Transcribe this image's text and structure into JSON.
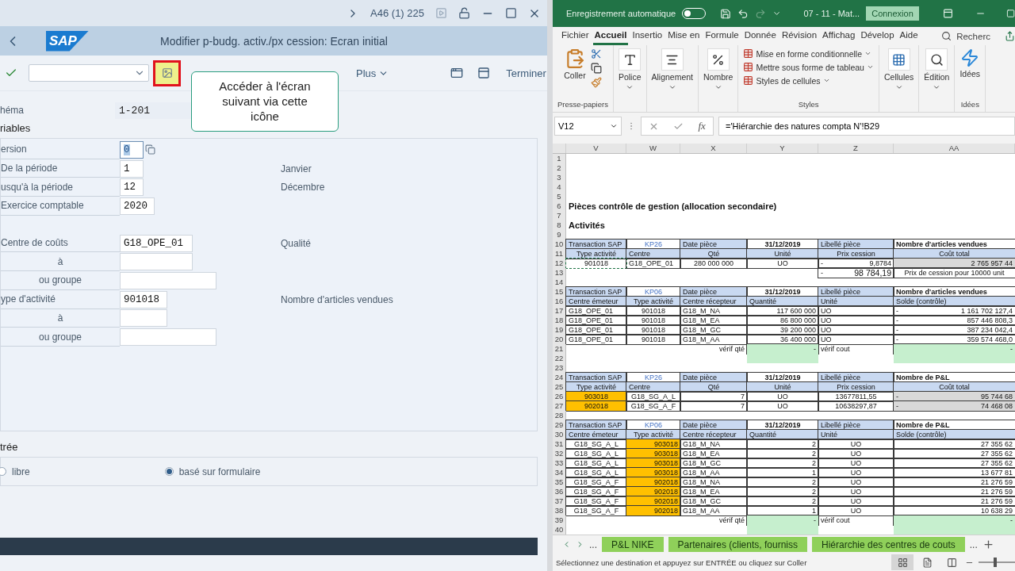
{
  "sap": {
    "titlebar": {
      "session": "A46 (1) 225"
    },
    "header": {
      "logo": "SAP",
      "title": "Modifier p-budg. activ./px cession: Ecran initial"
    },
    "toolbar": {
      "more": "Plus",
      "exit": "Terminer"
    },
    "tooltip": "Accéder à l'écran suivant via cette icône",
    "schema": {
      "label": "héma",
      "value": "1-201"
    },
    "section": "riables",
    "field_groups": [
      [
        {
          "kind": "main",
          "label": "ersion",
          "value": "0",
          "focused": true
        },
        {
          "kind": "main",
          "label": "De la période",
          "value": "1",
          "note": "Janvier",
          "focused": false
        },
        {
          "kind": "main",
          "label": "usqu'à la période",
          "value": "12",
          "note": "Décembre",
          "focused": false
        },
        {
          "kind": "main",
          "label": "Exercice comptable",
          "value": "2020",
          "focused": false
        }
      ],
      [
        {
          "kind": "main",
          "label": "Centre de coûts",
          "value": "G18_OPE_01",
          "note": "Qualité",
          "focused": false
        },
        {
          "kind": "to",
          "label": "à",
          "focused": false
        },
        {
          "kind": "group",
          "label": "ou groupe",
          "focused": false
        },
        {
          "kind": "main",
          "label": "ype d'activité",
          "value": "901018",
          "note": "Nombre d'articles vendues",
          "focused": false
        },
        {
          "kind": "to",
          "label": "à",
          "focused": false
        },
        {
          "kind": "group",
          "label": "ou groupe",
          "focused": false
        }
      ]
    ],
    "entry": {
      "heading": "trée",
      "options": [
        {
          "label": "libre",
          "selected": false
        },
        {
          "label": "basé sur formulaire",
          "selected": true
        }
      ]
    }
  },
  "excel": {
    "titlebar": {
      "autosave": {
        "label": "Enregistrement automatique",
        "on": false
      },
      "redo_disabled": true,
      "file": "07 - 11 - Mat...",
      "signin": "Connexion"
    },
    "tabs": [
      {
        "label": "Fichier",
        "selected": false
      },
      {
        "label": "Accueil",
        "selected": true
      },
      {
        "label": "Insertio",
        "selected": false
      },
      {
        "label": "Mise en",
        "selected": false
      },
      {
        "label": "Formule",
        "selected": false
      },
      {
        "label": "Donnée",
        "selected": false
      },
      {
        "label": "Révision",
        "selected": false
      },
      {
        "label": "Affichag",
        "selected": false
      },
      {
        "label": "Dévelop",
        "selected": false
      },
      {
        "label": "Aide",
        "selected": false
      }
    ],
    "search": "Recherc",
    "ribbon": {
      "clipboard": {
        "paste": "Coller",
        "group": "Presse-papiers"
      },
      "buttons": [
        {
          "kind": "font",
          "label": "Police"
        },
        {
          "kind": "align",
          "label": "Alignement"
        },
        {
          "kind": "number",
          "label": "Nombre"
        }
      ],
      "styles": {
        "items": [
          "Mise en forme conditionnelle",
          "Mettre sous forme de tableau",
          "Styles de cellules"
        ],
        "group": "Styles"
      },
      "after": [
        {
          "kind": "cells",
          "label": "Cellules"
        },
        {
          "kind": "edit",
          "label": "Édition"
        },
        {
          "kind": "ideas",
          "label": "Idées",
          "group": "Idées"
        }
      ]
    },
    "namebox": "V12",
    "fx": "fx",
    "formula": "='Hiérarchie des natures compta N'!B29",
    "columns": [
      "V",
      "W",
      "X",
      "Y",
      "Z",
      "AA"
    ],
    "rows": [
      {
        "n": "1",
        "cells": []
      },
      {
        "n": "2",
        "cells": []
      },
      {
        "n": "3",
        "cells": []
      },
      {
        "n": "4",
        "cells": []
      },
      {
        "n": "5",
        "cells": []
      },
      {
        "n": "6",
        "cells": [
          {
            "kind": "title",
            "text": "Pièces contrôle de gestion (allocation secondaire)"
          }
        ]
      },
      {
        "n": "7",
        "cells": []
      },
      {
        "n": "8",
        "cells": [
          {
            "kind": "title",
            "text": "Activités"
          }
        ]
      },
      {
        "n": "9",
        "cells": []
      },
      {
        "n": "10",
        "cells": [
          {
            "kind": "head",
            "text": "Transaction SAP"
          },
          {
            "kind": "link",
            "text": "KP26"
          },
          {
            "kind": "head",
            "text": "Date pièce"
          },
          {
            "kind": "date",
            "text": "31/12/2019"
          },
          {
            "kind": "head",
            "text": "Libellé pièce"
          },
          {
            "kind": "bold",
            "text": "Nombre d'articles vendues"
          }
        ]
      },
      {
        "n": "11",
        "cells": [
          {
            "kind": "headc",
            "text": "Type activité"
          },
          {
            "kind": "head",
            "text": "Centre"
          },
          {
            "kind": "headc",
            "text": "Qté"
          },
          {
            "kind": "headc",
            "text": "Unité"
          },
          {
            "kind": "headc",
            "text": "Prix cession"
          },
          {
            "kind": "headc",
            "text": "Coût total"
          }
        ]
      },
      {
        "n": "12",
        "cells": [
          {
            "kind": "copied",
            "text": "901018"
          },
          {
            "kind": "left",
            "text": "G18_OPE_01"
          },
          {
            "kind": "center",
            "text": "280 000 000"
          },
          {
            "kind": "center",
            "text": "UO"
          },
          {
            "kind": "acct",
            "sign": "-",
            "text": "9,8784"
          },
          {
            "kind": "grey",
            "text": "2 765 957 44"
          }
        ]
      },
      {
        "n": "13",
        "cells": [
          null,
          null,
          null,
          null,
          {
            "kind": "acctbig",
            "sign": "-",
            "text": "98 784,19"
          },
          {
            "kind": "center",
            "text": "Prix de cession pour 10000 unit"
          }
        ]
      },
      {
        "n": "14",
        "cells": []
      },
      {
        "n": "15",
        "cells": [
          {
            "kind": "head",
            "text": "Transaction SAP"
          },
          {
            "kind": "link",
            "text": "KP06"
          },
          {
            "kind": "head",
            "text": "Date pièce"
          },
          {
            "kind": "date",
            "text": "31/12/2019"
          },
          {
            "kind": "head",
            "text": "Libellé pièce"
          },
          {
            "kind": "bold",
            "text": "Nombre d'articles vendues"
          }
        ]
      },
      {
        "n": "16",
        "cells": [
          {
            "kind": "head",
            "text": "Centre émeteur"
          },
          {
            "kind": "headc",
            "text": "Type activité"
          },
          {
            "kind": "head",
            "text": "Centre récepteur"
          },
          {
            "kind": "head",
            "text": "Quantité"
          },
          {
            "kind": "head",
            "text": "Unité"
          },
          {
            "kind": "head",
            "text": "Solde (contrôle)"
          }
        ]
      },
      {
        "n": "17",
        "cells": [
          {
            "kind": "left",
            "text": "G18_OPE_01"
          },
          {
            "kind": "center",
            "text": "901018"
          },
          {
            "kind": "left",
            "text": "G18_M_NA"
          },
          {
            "kind": "right",
            "text": "117 600 000"
          },
          {
            "kind": "left",
            "text": "UO"
          },
          {
            "kind": "acct",
            "sign": "-",
            "text": "1 161 702 127,4"
          }
        ]
      },
      {
        "n": "18",
        "cells": [
          {
            "kind": "left",
            "text": "G18_OPE_01"
          },
          {
            "kind": "center",
            "text": "901018"
          },
          {
            "kind": "left",
            "text": "G18_M_EA"
          },
          {
            "kind": "right",
            "text": "86 800 000"
          },
          {
            "kind": "left",
            "text": "UO"
          },
          {
            "kind": "acct",
            "sign": "-",
            "text": "857 446 808,3"
          }
        ]
      },
      {
        "n": "19",
        "cells": [
          {
            "kind": "left",
            "text": "G18_OPE_01"
          },
          {
            "kind": "center",
            "text": "901018"
          },
          {
            "kind": "left",
            "text": "G18_M_GC"
          },
          {
            "kind": "right",
            "text": "39 200 000"
          },
          {
            "kind": "left",
            "text": "UO"
          },
          {
            "kind": "acct",
            "sign": "-",
            "text": "387 234 042,4"
          }
        ]
      },
      {
        "n": "20",
        "cells": [
          {
            "kind": "left",
            "text": "G18_OPE_01"
          },
          {
            "kind": "center",
            "text": "901018"
          },
          {
            "kind": "left",
            "text": "G18_M_AA"
          },
          {
            "kind": "right",
            "text": "36 400 000"
          },
          {
            "kind": "left",
            "text": "UO"
          },
          {
            "kind": "acct",
            "sign": "-",
            "text": "359 574 468,0"
          }
        ]
      },
      {
        "n": "21",
        "cells": [
          null,
          null,
          {
            "kind": "note",
            "text": "vérif qté"
          },
          {
            "kind": "green",
            "text": "-"
          },
          {
            "kind": "noteleft",
            "text": "vérif cout"
          },
          {
            "kind": "green",
            "text": "-"
          }
        ]
      },
      {
        "n": "22",
        "cells": [
          null,
          null,
          null,
          {
            "kind": "greenopen"
          },
          null,
          {
            "kind": "greenopen"
          }
        ]
      },
      {
        "n": "23",
        "cells": []
      },
      {
        "n": "24",
        "cells": [
          {
            "kind": "head",
            "text": "Transaction SAP"
          },
          {
            "kind": "link",
            "text": "KP26"
          },
          {
            "kind": "head",
            "text": "Date pièce"
          },
          {
            "kind": "date",
            "text": "31/12/2019"
          },
          {
            "kind": "head",
            "text": "Libellé pièce"
          },
          {
            "kind": "bold",
            "text": "Nombre de P&L"
          }
        ]
      },
      {
        "n": "25",
        "cells": [
          {
            "kind": "headc",
            "text": "Type activité"
          },
          {
            "kind": "head",
            "text": "Centre"
          },
          {
            "kind": "headc",
            "text": "Qté"
          },
          {
            "kind": "headc",
            "text": "Unité"
          },
          {
            "kind": "headc",
            "text": "Prix cession"
          },
          {
            "kind": "headc",
            "text": "Coût total"
          }
        ]
      },
      {
        "n": "26",
        "cells": [
          {
            "kind": "orange",
            "text": "903018"
          },
          {
            "kind": "center",
            "text": "G18_SG_A_L"
          },
          {
            "kind": "right",
            "text": "7"
          },
          {
            "kind": "center",
            "text": "UO"
          },
          {
            "kind": "center",
            "text": "13677811,55"
          },
          {
            "kind": "greyacct",
            "sign": "-",
            "text": "95 744 68"
          }
        ]
      },
      {
        "n": "27",
        "cells": [
          {
            "kind": "orange",
            "text": "902018"
          },
          {
            "kind": "center",
            "text": "G18_SG_A_F"
          },
          {
            "kind": "right",
            "text": "7"
          },
          {
            "kind": "center",
            "text": "UO"
          },
          {
            "kind": "center",
            "text": "10638297,87"
          },
          {
            "kind": "greyacct",
            "sign": "-",
            "text": "74 468 08"
          }
        ]
      },
      {
        "n": "28",
        "cells": []
      },
      {
        "n": "29",
        "cells": [
          {
            "kind": "head",
            "text": "Transaction SAP"
          },
          {
            "kind": "link",
            "text": "KP06"
          },
          {
            "kind": "head",
            "text": "Date pièce"
          },
          {
            "kind": "date",
            "text": "31/12/2019"
          },
          {
            "kind": "head",
            "text": "Libellé pièce"
          },
          {
            "kind": "bold",
            "text": "Nombre de P&L"
          }
        ]
      },
      {
        "n": "30",
        "cells": [
          {
            "kind": "head",
            "text": "Centre émeteur"
          },
          {
            "kind": "headc",
            "text": "Type activité"
          },
          {
            "kind": "head",
            "text": "Centre récepteur"
          },
          {
            "kind": "head",
            "text": "Quantité"
          },
          {
            "kind": "head",
            "text": "Unité"
          },
          {
            "kind": "head",
            "text": "Solde (contrôle)"
          }
        ]
      },
      {
        "n": "31",
        "cells": [
          {
            "kind": "center",
            "text": "G18_SG_A_L"
          },
          {
            "kind": "oranger",
            "text": "903018"
          },
          {
            "kind": "left",
            "text": "G18_M_NA"
          },
          {
            "kind": "right",
            "text": "2"
          },
          {
            "kind": "center",
            "text": "UO"
          },
          {
            "kind": "right",
            "text": "27 355 62"
          }
        ]
      },
      {
        "n": "32",
        "cells": [
          {
            "kind": "center",
            "text": "G18_SG_A_L"
          },
          {
            "kind": "oranger",
            "text": "903018"
          },
          {
            "kind": "left",
            "text": "G18_M_EA"
          },
          {
            "kind": "right",
            "text": "2"
          },
          {
            "kind": "center",
            "text": "UO"
          },
          {
            "kind": "right",
            "text": "27 355 62"
          }
        ]
      },
      {
        "n": "33",
        "cells": [
          {
            "kind": "center",
            "text": "G18_SG_A_L"
          },
          {
            "kind": "oranger",
            "text": "903018"
          },
          {
            "kind": "left",
            "text": "G18_M_GC"
          },
          {
            "kind": "right",
            "text": "2"
          },
          {
            "kind": "center",
            "text": "UO"
          },
          {
            "kind": "right",
            "text": "27 355 62"
          }
        ]
      },
      {
        "n": "34",
        "cells": [
          {
            "kind": "center",
            "text": "G18_SG_A_L"
          },
          {
            "kind": "oranger",
            "text": "903018"
          },
          {
            "kind": "left",
            "text": "G18_M_AA"
          },
          {
            "kind": "right",
            "text": "1"
          },
          {
            "kind": "center",
            "text": "UO"
          },
          {
            "kind": "right",
            "text": "13 677 81"
          }
        ]
      },
      {
        "n": "35",
        "cells": [
          {
            "kind": "center",
            "text": "G18_SG_A_F"
          },
          {
            "kind": "oranger",
            "text": "902018"
          },
          {
            "kind": "left",
            "text": "G18_M_NA"
          },
          {
            "kind": "right",
            "text": "2"
          },
          {
            "kind": "center",
            "text": "UO"
          },
          {
            "kind": "right",
            "text": "21 276 59"
          }
        ]
      },
      {
        "n": "36",
        "cells": [
          {
            "kind": "center",
            "text": "G18_SG_A_F"
          },
          {
            "kind": "oranger",
            "text": "902018"
          },
          {
            "kind": "left",
            "text": "G18_M_EA"
          },
          {
            "kind": "right",
            "text": "2"
          },
          {
            "kind": "center",
            "text": "UO"
          },
          {
            "kind": "right",
            "text": "21 276 59"
          }
        ]
      },
      {
        "n": "37",
        "cells": [
          {
            "kind": "center",
            "text": "G18_SG_A_F"
          },
          {
            "kind": "oranger",
            "text": "902018"
          },
          {
            "kind": "left",
            "text": "G18_M_GC"
          },
          {
            "kind": "right",
            "text": "2"
          },
          {
            "kind": "center",
            "text": "UO"
          },
          {
            "kind": "right",
            "text": "21 276 59"
          }
        ]
      },
      {
        "n": "38",
        "cells": [
          {
            "kind": "center",
            "text": "G18_SG_A_F"
          },
          {
            "kind": "oranger",
            "text": "902018"
          },
          {
            "kind": "left",
            "text": "G18_M_AA"
          },
          {
            "kind": "right",
            "text": "1"
          },
          {
            "kind": "center",
            "text": "UO"
          },
          {
            "kind": "right",
            "text": "10 638 29"
          }
        ]
      },
      {
        "n": "39",
        "cells": [
          null,
          null,
          {
            "kind": "note",
            "text": "vérif qté"
          },
          {
            "kind": "green",
            "text": "-"
          },
          {
            "kind": "noteleft",
            "text": "vérif cout"
          },
          {
            "kind": "green",
            "text": "-"
          }
        ]
      },
      {
        "n": "40",
        "cells": [
          null,
          null,
          null,
          {
            "kind": "greenopen"
          },
          null,
          {
            "kind": "greenopen"
          }
        ]
      }
    ],
    "sheet_nav": {
      "more_left": "...",
      "more_right": "..."
    },
    "sheets": [
      {
        "label": "P&L NIKE",
        "selected": false
      },
      {
        "label": "Partenaires (clients, fourniss",
        "selected": false
      },
      {
        "label": "Hiérarchie des centres de couts",
        "selected": false
      }
    ],
    "status": "Sélectionnez une destination et appuyez sur ENTRÉE ou cliquez sur Coller",
    "views": [
      {
        "kind": "normal",
        "selected": true
      },
      {
        "kind": "page",
        "selected": false
      },
      {
        "kind": "break",
        "selected": false
      }
    ],
    "zoom": {
      "level": 0.45
    }
  }
}
